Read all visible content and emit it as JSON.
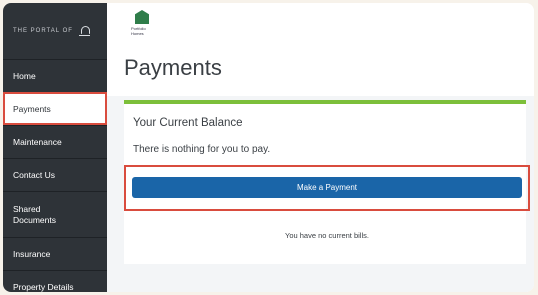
{
  "sidebar": {
    "portal_label": "THE PORTAL OF",
    "items": [
      {
        "label": "Home"
      },
      {
        "label": "Payments"
      },
      {
        "label": "Maintenance"
      },
      {
        "label": "Contact Us"
      },
      {
        "label": "Shared Documents"
      },
      {
        "label": "Insurance"
      },
      {
        "label": "Property Details"
      }
    ]
  },
  "header": {
    "logo_text": "Portfolio Homes",
    "title": "Payments"
  },
  "balance": {
    "heading": "Your Current Balance",
    "message": "There is nothing for you to pay.",
    "button_label": "Make a Payment",
    "note": "You have no current bills."
  },
  "colors": {
    "sidebar_bg": "#2e3338",
    "accent_green": "#7cbf3a",
    "button_blue": "#1a65a8",
    "highlight_red": "#d94c3e"
  }
}
